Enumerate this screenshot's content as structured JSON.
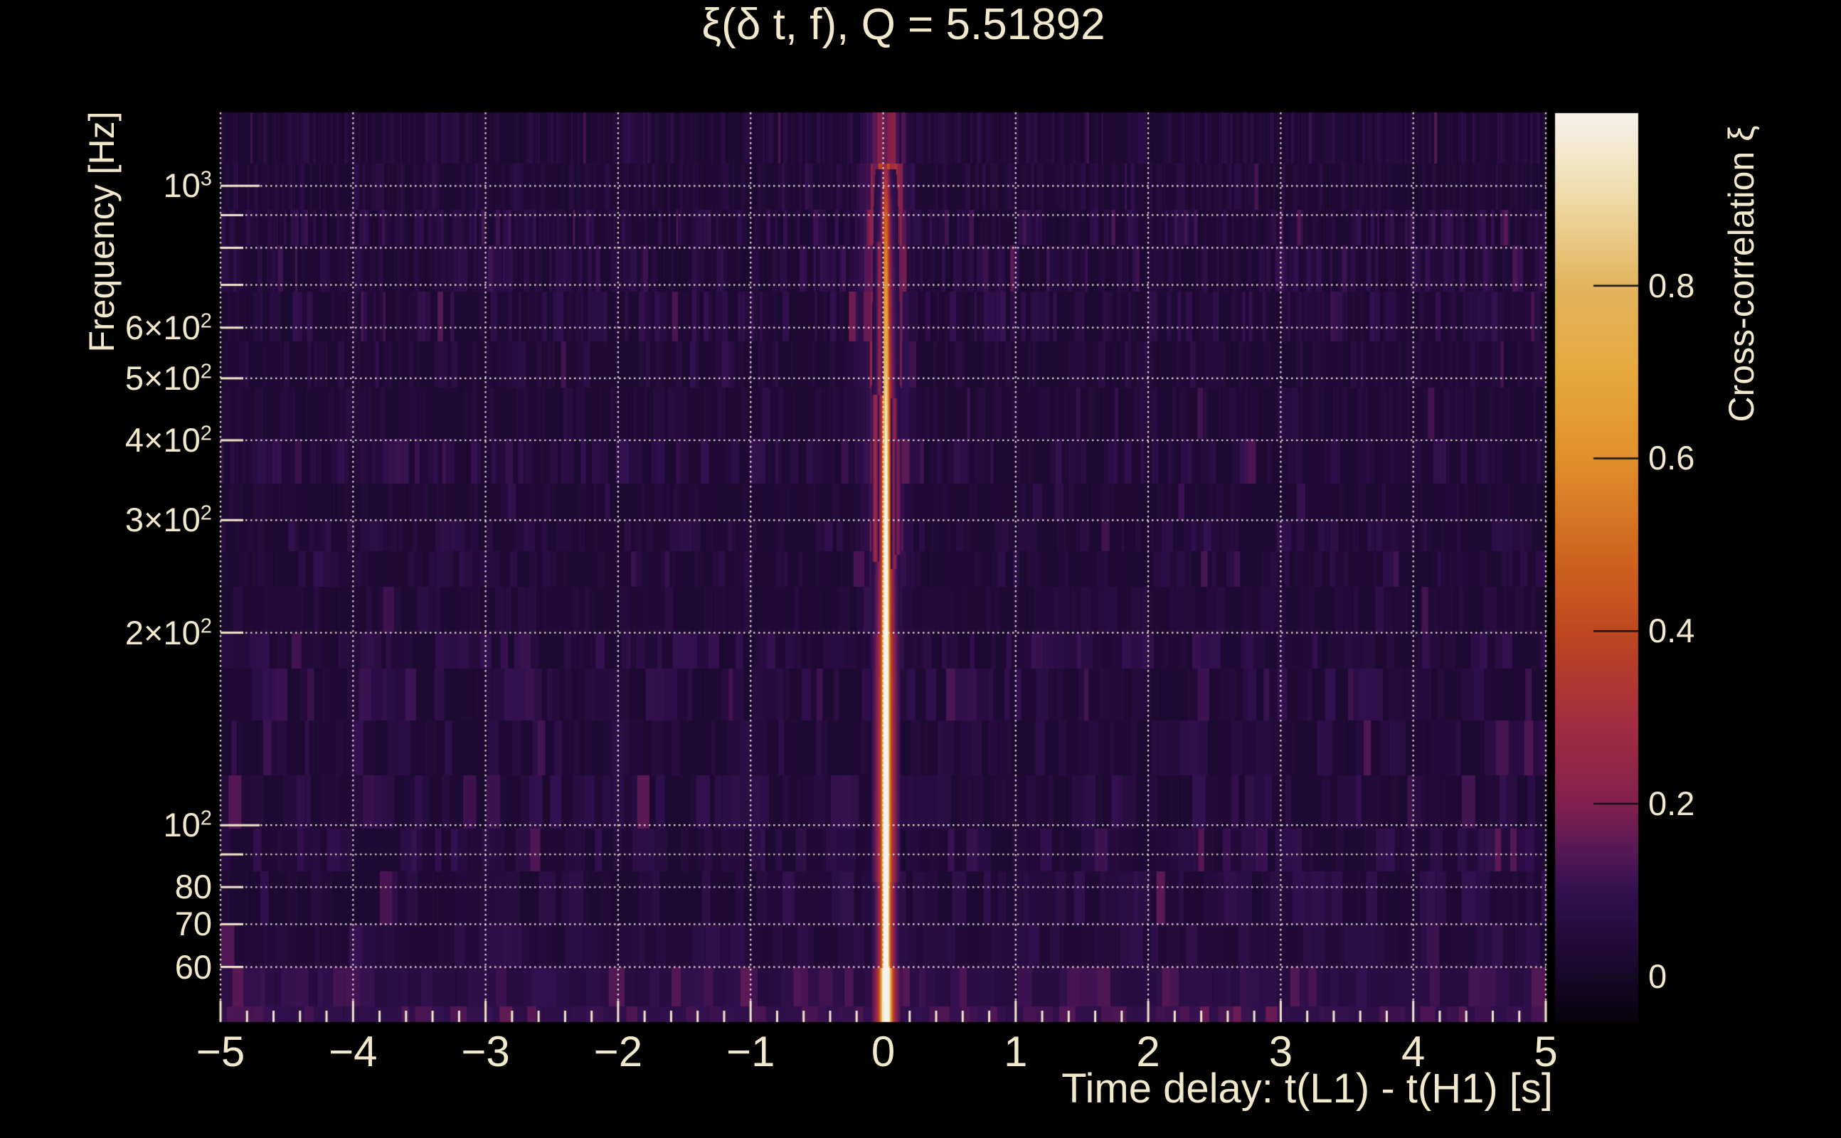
{
  "title": "ξ(δ t, f), Q = 5.51892",
  "q_value": "5.51892",
  "colors": {
    "background": "#000000",
    "text": "#f2e9cd",
    "grid_dots": "#f6f0dc",
    "colorbar_tick": "#101010",
    "heatmap_base": "#1d0e29"
  },
  "axes": {
    "x": {
      "label": "Time delay: t(L1) - t(H1) [s]",
      "min": -5,
      "max": 5,
      "minor_tick_step": 0.2,
      "ticks": [
        {
          "value": -5,
          "label": "−5"
        },
        {
          "value": -4,
          "label": "−4"
        },
        {
          "value": -3,
          "label": "−3"
        },
        {
          "value": -2,
          "label": "−2"
        },
        {
          "value": -1,
          "label": "−1"
        },
        {
          "value": 0,
          "label": "0"
        },
        {
          "value": 1,
          "label": "1"
        },
        {
          "value": 2,
          "label": "2"
        },
        {
          "value": 3,
          "label": "3"
        },
        {
          "value": 4,
          "label": "4"
        },
        {
          "value": 5,
          "label": "5"
        }
      ]
    },
    "y": {
      "label": "Frequency [Hz]",
      "scale": "log",
      "min": 49.2,
      "max": 1303,
      "major_ticks": [
        100,
        1000
      ],
      "gridlines": [
        60,
        70,
        80,
        90,
        100,
        200,
        300,
        400,
        500,
        600,
        700,
        800,
        900,
        1000
      ],
      "ticks": [
        {
          "value": 1000,
          "label": "10^3"
        },
        {
          "value": 600,
          "label": "6×10^2"
        },
        {
          "value": 500,
          "label": "5×10^2"
        },
        {
          "value": 400,
          "label": "4×10^2"
        },
        {
          "value": 300,
          "label": "3×10^2"
        },
        {
          "value": 200,
          "label": "2×10^2"
        },
        {
          "value": 100,
          "label": "10^2"
        },
        {
          "value": 80,
          "label": "80"
        },
        {
          "value": 70,
          "label": "70"
        },
        {
          "value": 60,
          "label": "60"
        }
      ]
    }
  },
  "colorbar": {
    "label": "Cross-correlation ξ",
    "min": -0.053,
    "max": 1.0,
    "ticks": [
      {
        "value": 0.8,
        "label": "0.8"
      },
      {
        "value": 0.6,
        "label": "0.6"
      },
      {
        "value": 0.4,
        "label": "0.4"
      },
      {
        "value": 0.2,
        "label": "0.2"
      },
      {
        "value": 0.0,
        "label": "0"
      }
    ],
    "colormap_stops": [
      [
        -0.06,
        "#040106"
      ],
      [
        0.0,
        "#16082a"
      ],
      [
        0.1,
        "#33104f"
      ],
      [
        0.15,
        "#5a1955"
      ],
      [
        0.2,
        "#83204f"
      ],
      [
        0.3,
        "#a52e3f"
      ],
      [
        0.4,
        "#bf481f"
      ],
      [
        0.5,
        "#d2691f"
      ],
      [
        0.6,
        "#e18f2c"
      ],
      [
        0.7,
        "#e6a83e"
      ],
      [
        0.8,
        "#e2b45c"
      ],
      [
        0.9,
        "#efd9a6"
      ],
      [
        1.0,
        "#f6f3ec"
      ]
    ]
  },
  "chart_data": {
    "type": "heatmap",
    "title": "ξ(δ t, f), Q = 5.51892",
    "xlabel": "Time delay: t(L1) - t(H1) [s]",
    "ylabel": "Frequency [Hz]",
    "zlabel": "Cross-correlation ξ",
    "x_range": [
      -5,
      5
    ],
    "y_range_hz": [
      49.2,
      1303
    ],
    "y_scale": "log",
    "z_range": [
      -0.053,
      1.0
    ],
    "q": 5.51892,
    "background_xi_level": 0.05,
    "ridge_xi_vs_freq": [
      [
        50,
        0.97
      ],
      [
        80,
        0.96
      ],
      [
        100,
        0.96
      ],
      [
        150,
        0.92
      ],
      [
        200,
        0.85
      ],
      [
        300,
        0.7
      ],
      [
        470,
        0.6
      ],
      [
        600,
        0.48
      ],
      [
        900,
        0.32
      ],
      [
        1100,
        0.26
      ],
      [
        1300,
        0.18
      ]
    ],
    "features": [
      {
        "name": "zero-delay ridge",
        "dt": 0.0,
        "freq_range_hz": [
          50,
          1300
        ],
        "peak_xi": 0.97,
        "description": "Narrow bright vertical line at δt ≈ 0 spanning the full band; white-hot (ξ≈0.95) below ~150 Hz, orange ~200–450 Hz, fading to pink above"
      },
      {
        "name": "broad correlated column",
        "dt_range": [
          -0.13,
          0.12
        ],
        "freq_range_hz": [
          250,
          1300
        ],
        "xi": 0.3,
        "description": "Wider moderate-correlation pink column around δt = 0 at high frequencies"
      },
      {
        "name": "background",
        "xi_range": [
          0.0,
          0.12
        ],
        "description": "Dark purple background with random vertical striping per Q-transform frequency row; slightly brighter band below 60 Hz"
      }
    ]
  },
  "layout_note": ""
}
